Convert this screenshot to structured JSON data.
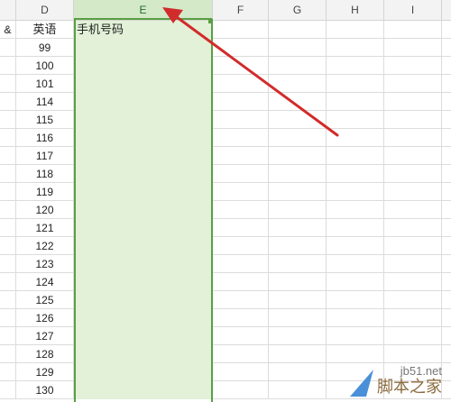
{
  "columns": [
    {
      "label": "",
      "partial": true
    },
    {
      "label": "D"
    },
    {
      "label": "E",
      "selected": true
    },
    {
      "label": "F"
    },
    {
      "label": "G"
    },
    {
      "label": "H"
    },
    {
      "label": "I"
    }
  ],
  "row1": {
    "partial_left": "&",
    "d": "英语",
    "e": "手机号码"
  },
  "scores": [
    "99",
    "100",
    "101",
    "114",
    "115",
    "116",
    "117",
    "118",
    "119",
    "120",
    "121",
    "122",
    "123",
    "124",
    "125",
    "126",
    "127",
    "128",
    "129",
    "130"
  ],
  "colors": {
    "selection": "#5a9e44",
    "selection_fill": "#e2f1d8",
    "arrow": "#d22b2b"
  },
  "watermark": {
    "url": "jb51.net",
    "name": "脚本之家"
  }
}
